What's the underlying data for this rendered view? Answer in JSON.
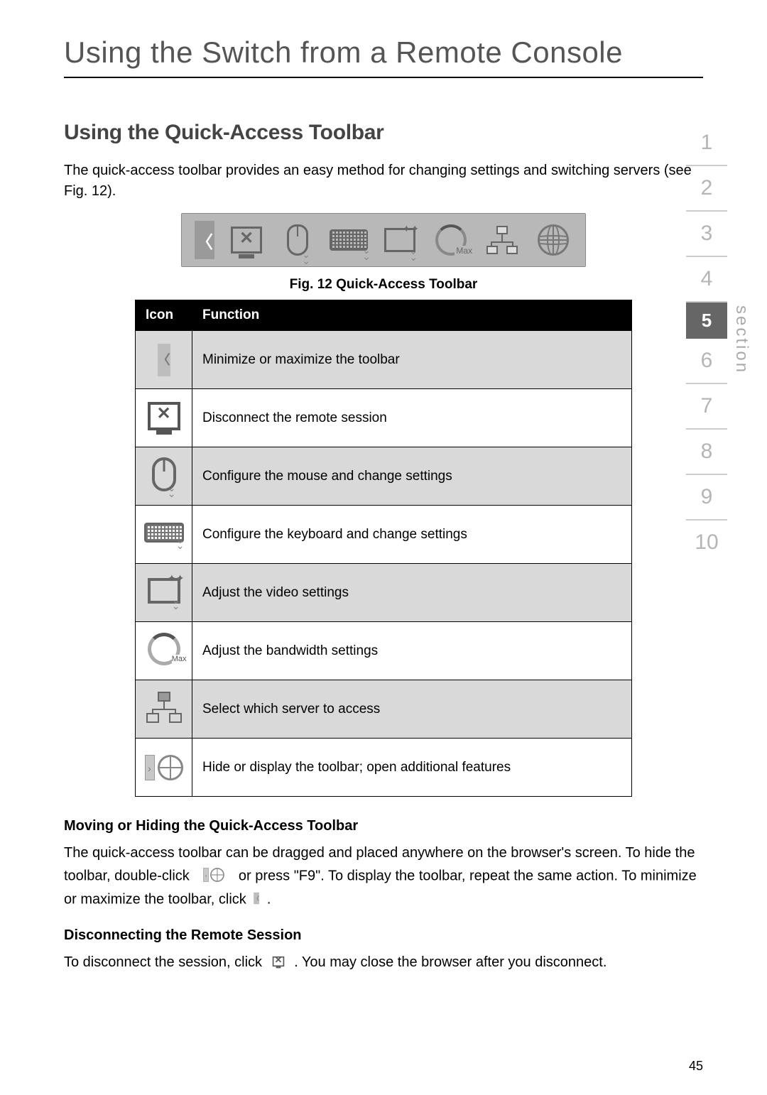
{
  "page_title": "Using the Switch from a Remote Console",
  "section_heading": "Using the Quick-Access Toolbar",
  "intro_text": "The quick-access toolbar provides an easy method for changing settings and switching servers (see Fig. 12).",
  "figure_caption": "Fig. 12 Quick-Access Toolbar",
  "table": {
    "head_icon": "Icon",
    "head_function": "Function",
    "rows": [
      {
        "icon": "chevron-left-icon",
        "func": "Minimize or maximize the toolbar"
      },
      {
        "icon": "disconnect-monitor-icon",
        "func": "Disconnect the remote session"
      },
      {
        "icon": "mouse-icon",
        "func": "Configure the mouse and change settings"
      },
      {
        "icon": "keyboard-icon",
        "func": "Configure the keyboard and change settings"
      },
      {
        "icon": "video-settings-icon",
        "func": "Adjust the video settings"
      },
      {
        "icon": "bandwidth-gauge-icon",
        "func": "Adjust the bandwidth settings"
      },
      {
        "icon": "server-select-tree-icon",
        "func": "Select which server to access"
      },
      {
        "icon": "toolbar-toggle-globe-icon",
        "func": "Hide or display the toolbar; open additional features"
      }
    ]
  },
  "moving_heading": "Moving or Hiding the Quick-Access Toolbar",
  "moving_text_1": "The quick-access toolbar can be dragged and placed anywhere on the browser's screen. To hide the toolbar, double-click ",
  "moving_text_2": " or press \"F9\". To display the toolbar, repeat the same action. To minimize or maximize the toolbar, click ",
  "moving_text_3": ".",
  "disconnect_heading": "Disconnecting the Remote Session",
  "disconnect_text_1": "To disconnect the session, click ",
  "disconnect_text_2": ". You may close the browser after you disconnect.",
  "nav": {
    "items": [
      "1",
      "2",
      "3",
      "4",
      "5",
      "6",
      "7",
      "8",
      "9",
      "10"
    ],
    "active_index": 4,
    "label": "section"
  },
  "page_number": "45"
}
